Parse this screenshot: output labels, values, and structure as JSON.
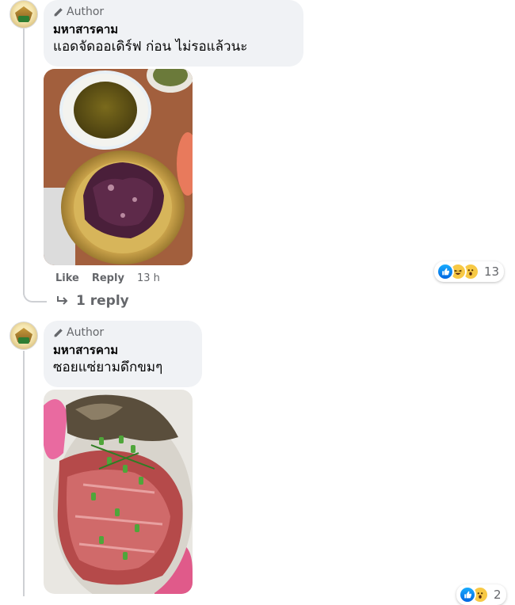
{
  "comments": [
    {
      "badge": "Author",
      "author": "มหาสารคาม",
      "text": "แอดจัดออเดิร์ฟ ก่อน ไม่รอแล้วนะ",
      "photo": "photo of grilled meat plate with jaew dipping sauce",
      "actions": {
        "like": "Like",
        "reply": "Reply",
        "time": "13 h"
      },
      "reaction_count": "13",
      "reactions": [
        "like-icon",
        "haha-icon",
        "wow-icon"
      ],
      "replies_link": "1 reply"
    },
    {
      "badge": "Author",
      "author": "มหาสารคาม",
      "text": "ซอยแซ่ยามดึกขมๆ",
      "photo": "photo of raw beef with green onions",
      "reaction_count": "2",
      "reactions": [
        "like-icon",
        "wow-icon"
      ]
    }
  ],
  "colors": {
    "bubble": "#f0f2f5",
    "meta_text": "#65676b",
    "like_blue": "#0165e1",
    "thread_line": "#ced0d4"
  }
}
